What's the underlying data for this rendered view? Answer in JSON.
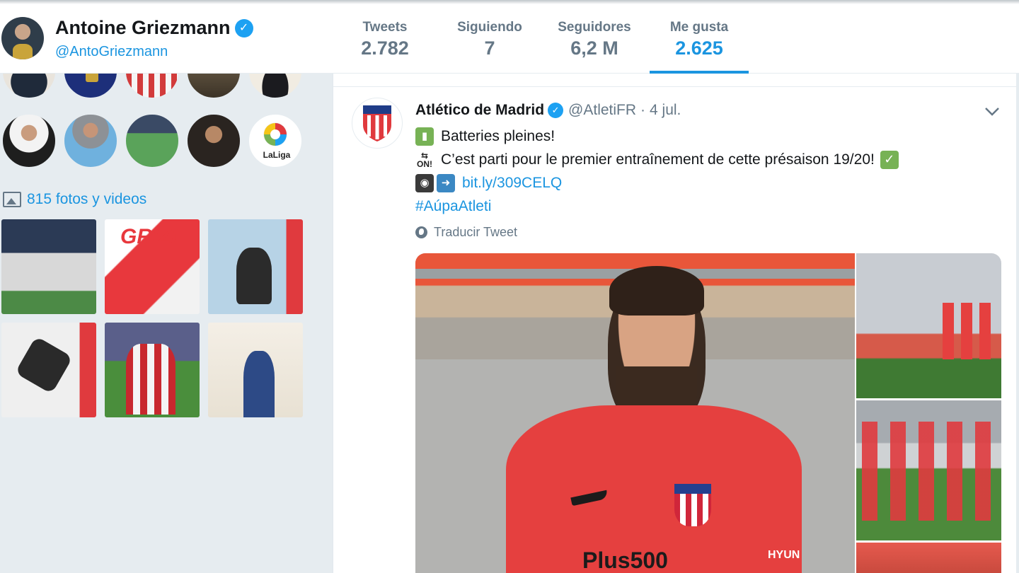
{
  "profile": {
    "name": "Antoine Griezmann",
    "handle": "@AntoGriezmann"
  },
  "stats": [
    {
      "label": "Tweets",
      "value": "2.782",
      "active": false
    },
    {
      "label": "Siguiendo",
      "value": "7",
      "active": false
    },
    {
      "label": "Seguidores",
      "value": "6,2 M",
      "active": false
    },
    {
      "label": "Me gusta",
      "value": "2.625",
      "active": true
    }
  ],
  "sidebar": {
    "media_count_label": "815 fotos y videos",
    "following_logo_text": "LaLiga",
    "thumb_text": "GRIZI"
  },
  "tweet": {
    "author": "Atlético de Madrid",
    "handle": "@AtletiFR",
    "separator": "·",
    "date": "4 jul.",
    "line1": "Batteries pleines!",
    "line2": "C’est parti pour le premier entraînement de cette présaison 19/20!",
    "link": "bit.ly/309CELQ",
    "hashtag": "#AúpaAtleti",
    "on_label": "ON!",
    "translate_label": "Traducir Tweet",
    "shirt_sponsor": "Plus500",
    "shirt_brand": "HYUN"
  },
  "colors": {
    "accent": "#1b95e0",
    "verified": "#1da1f2",
    "muted": "#657786",
    "atletico_red": "#e03a3e"
  }
}
